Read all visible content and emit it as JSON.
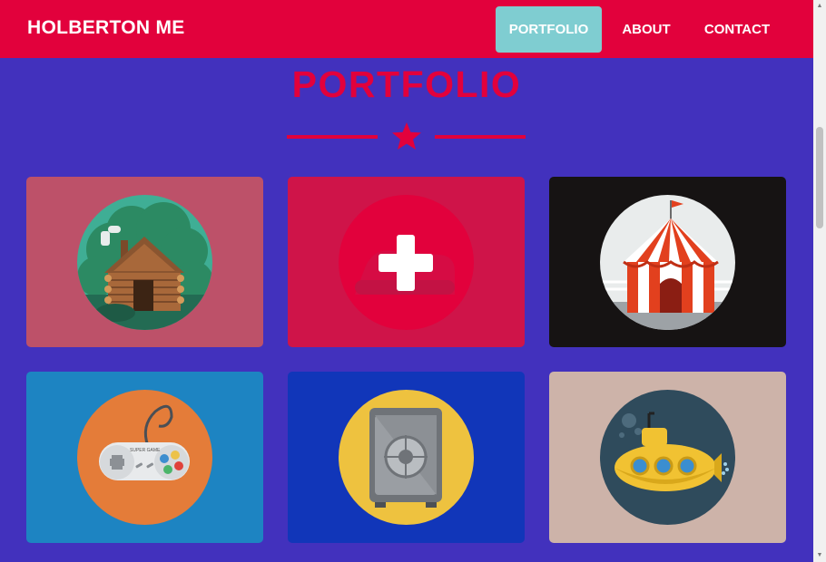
{
  "nav": {
    "brand": "HOLBERTON ME",
    "links": [
      {
        "label": "PORTFOLIO",
        "active": true
      },
      {
        "label": "ABOUT",
        "active": false
      },
      {
        "label": "CONTACT",
        "active": false
      }
    ]
  },
  "portfolio": {
    "title": "PORTFOLIO",
    "items": [
      {
        "icon": "log-cabin-icon",
        "background": "#bd5169"
      },
      {
        "icon": "plus-icon",
        "background": "#cf1449"
      },
      {
        "icon": "circus-tent-icon",
        "background": "#161313"
      },
      {
        "icon": "game-controller-icon",
        "background": "#1d84c2"
      },
      {
        "icon": "safe-icon",
        "background": "#1136b9"
      },
      {
        "icon": "submarine-icon",
        "background": "#cdb3a9"
      }
    ],
    "controller_text": "SUPER GAME"
  },
  "colors": {
    "accent": "#e2013c",
    "background": "#4231bd",
    "active_nav": "#7fcdd1"
  }
}
